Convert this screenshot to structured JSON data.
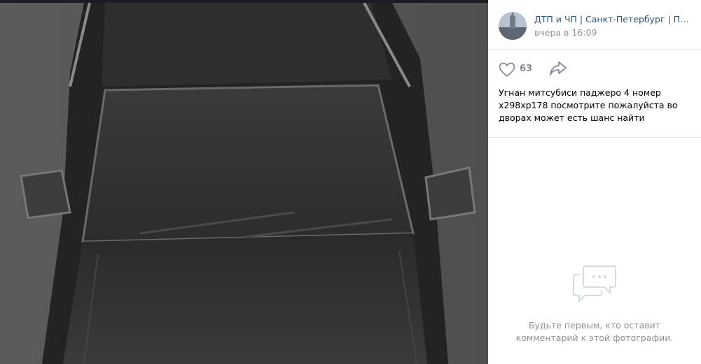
{
  "post": {
    "author_name": "ДТП и ЧП | Санкт-Петербург | Пите…",
    "date": "вчера в 16:09",
    "likes": "63",
    "description": "Угнан митсубиси паджеро 4 номер х298хр178 посмотрите пожалуйста во дворах может есть шанс найти"
  },
  "comments": {
    "empty_text_line1": "Будьте первым, кто оставит",
    "empty_text_line2": "комментарий к этой фотографии."
  },
  "colors": {
    "link": "#2a5885",
    "muted": "#939393",
    "icon": "#828a99",
    "comment_icon": "#d3dbe4"
  },
  "icons": {
    "like": "heart-outline-icon",
    "share": "share-arrow-icon",
    "comments_empty": "chat-bubbles-icon"
  }
}
